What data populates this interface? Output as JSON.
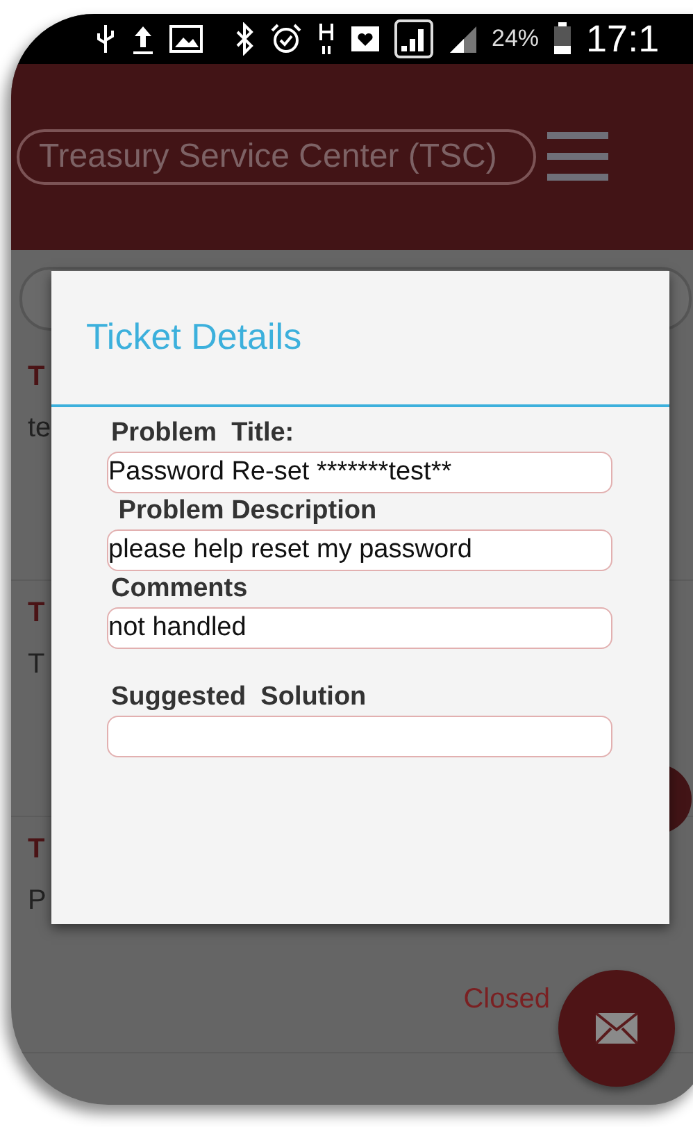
{
  "status_bar": {
    "battery": "24%",
    "time": "17:1"
  },
  "app_bar": {
    "title": "Treasury Service Center (TSC)"
  },
  "list": [
    {
      "title": "T",
      "text": "te"
    },
    {
      "title": "T",
      "text": "T"
    },
    {
      "title": "T",
      "text": "P",
      "status": "Closed"
    }
  ],
  "dialog": {
    "title": "Ticket Details",
    "fields": [
      {
        "label": "Problem  Title:",
        "value": "Password Re-set *******test**"
      },
      {
        "label": " Problem Description",
        "value": "please help reset my password"
      },
      {
        "label": "Comments",
        "value": "not handled"
      },
      {
        "label": "Suggested  Solution"
      }
    ]
  }
}
